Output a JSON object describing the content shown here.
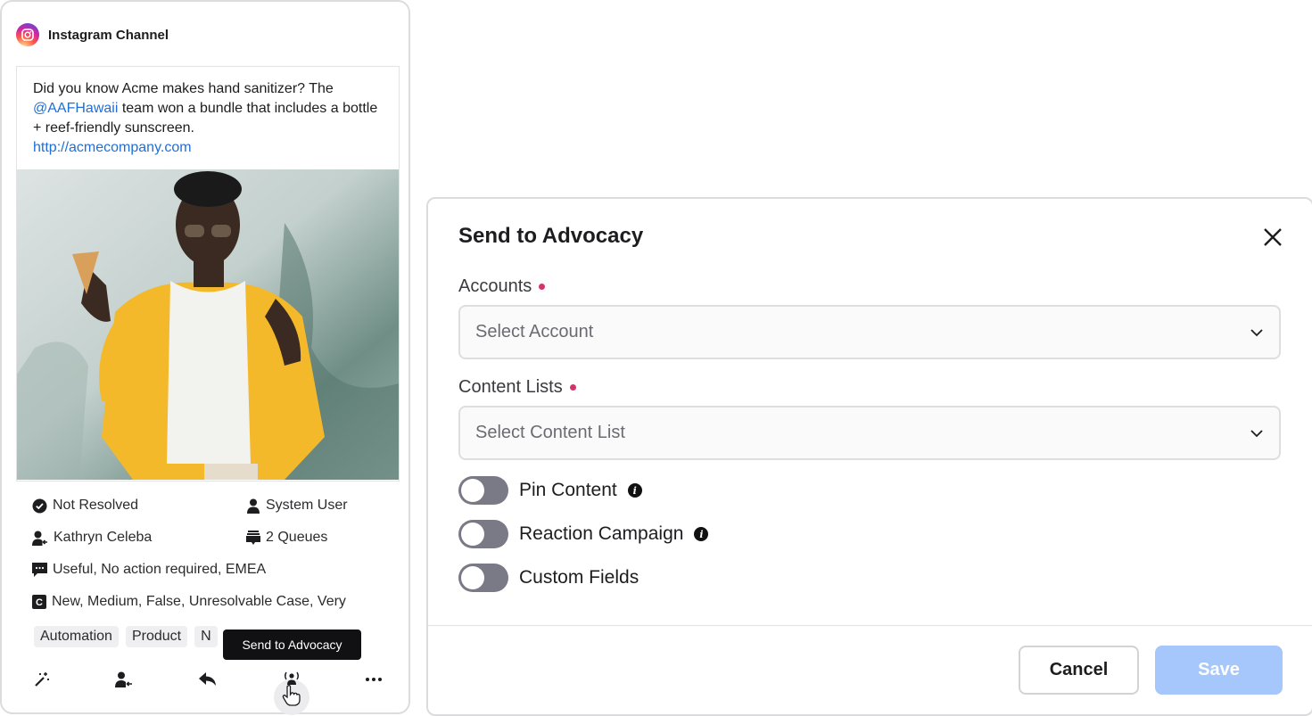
{
  "post": {
    "channel": "Instagram Channel",
    "text_before": "Did you know Acme makes hand sanitizer? The ",
    "mention": "@AAFHawaii",
    "text_after": " team won a bundle that includes a bottle + reef-friendly sunscreen.",
    "link": "http://acmecompany.com",
    "status": "Not Resolved",
    "user": "System User",
    "assignee": "Kathryn Celeba",
    "queues": "2 Queues",
    "tags_line": "Useful, No action required, EMEA",
    "custom_line": "New, Medium, False, Unresolvable Case, Very",
    "tag_chips": [
      "Automation",
      "Product",
      "N"
    ],
    "tooltip": "Send to Advocacy",
    "actions": [
      "magic-wand-icon",
      "assign-user-icon",
      "reply-icon",
      "advocacy-broadcast-icon",
      "more-icon"
    ]
  },
  "modal": {
    "title": "Send to Advocacy",
    "accounts_label": "Accounts",
    "accounts_placeholder": "Select Account",
    "content_lists_label": "Content Lists",
    "content_lists_placeholder": "Select Content List",
    "toggles": [
      {
        "label": "Pin Content",
        "on": false,
        "info": true
      },
      {
        "label": "Reaction Campaign",
        "on": false,
        "info": true
      },
      {
        "label": "Custom Fields",
        "on": false,
        "info": false
      }
    ],
    "cancel_label": "Cancel",
    "save_label": "Save"
  },
  "colors": {
    "link": "#1f6fd6",
    "required_dot": "#d6336c",
    "save_disabled": "#a5c7fb",
    "toggle_off": "#7a7a86"
  }
}
